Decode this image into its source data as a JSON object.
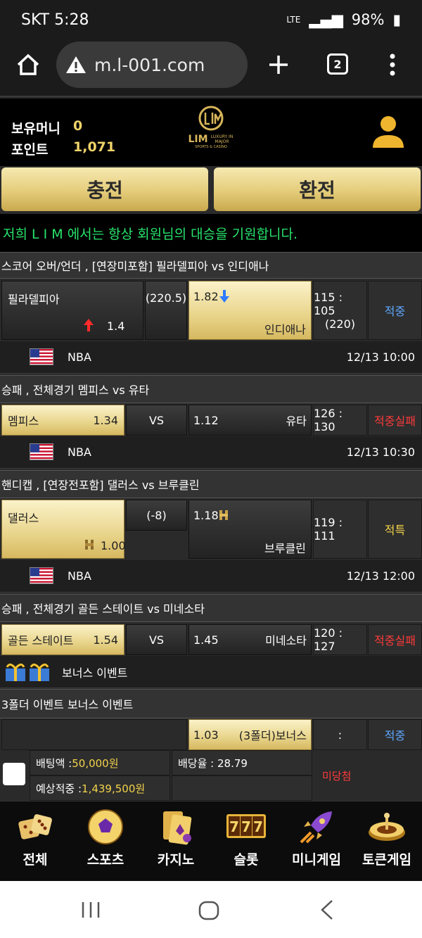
{
  "status_bar": {
    "carrier_time": "SKT 5:28",
    "battery": "98%",
    "network": "LTE"
  },
  "browser": {
    "url": "m.l-001.com",
    "tab_count": "2"
  },
  "header": {
    "money_label": "보유머니",
    "money_value": "0",
    "points_label": "포인트",
    "points_value": "1,071",
    "logo_text": "LIM",
    "logo_sub": "LUXURY IN MAJOR",
    "logo_tag": "SPORTS & CASINO"
  },
  "actions": {
    "deposit": "충전",
    "withdraw": "환전"
  },
  "marquee": "저희 L I M 에서는 항상 회원님의 대승을 기원합니다.",
  "bets": [
    {
      "title": "스코어 오버/언더 , [연장미포함] 필라델피아  vs  인디애나",
      "home": "필라델피아",
      "home_odds": "1.4",
      "middle": "(220.5)",
      "away": "인디애나",
      "away_odds": "1.82",
      "score": "115 : 105",
      "score_sub": "(220)",
      "result": "적중",
      "league": "NBA",
      "time": "12/13 10:00"
    },
    {
      "title": "승패 , 전체경기 멤피스  vs  유타",
      "home": "멤피스",
      "home_odds": "1.34",
      "middle": "VS",
      "away": "유타",
      "away_odds": "1.12",
      "score": "126 : 130",
      "result": "적중실패",
      "league": "NBA",
      "time": "12/13 10:30"
    },
    {
      "title": "핸디캡 , [연장전포함] 댈러스  vs  브루클린",
      "home": "댈러스",
      "home_odds": "1.00",
      "middle": "(-8)",
      "away": "브루클린",
      "away_odds": "1.18",
      "score": "119 : 111",
      "result": "적특",
      "league": "NBA",
      "time": "12/13 12:00"
    },
    {
      "title": "승패 , 전체경기 골든 스테이트  vs  미네소타",
      "home": "골든 스테이트",
      "home_odds": "1.54",
      "middle": "VS",
      "away": "미네소타",
      "away_odds": "1.45",
      "score": "120 : 127",
      "result": "적중실패"
    }
  ],
  "bonus_event": {
    "label": "보너스 이벤트"
  },
  "bonus_bet": {
    "title": "3폴더 이벤트 보너스 이벤트",
    "odds": "1.03",
    "label": "(3폴더)보너스",
    "score": ":",
    "result": "적중"
  },
  "summary": {
    "bet_amount_label": "배팅액 : ",
    "bet_amount": "50,000원",
    "odds_label": "배당율 : 28.79",
    "expected_label": "예상적중 : ",
    "expected": "1,439,500원",
    "status": "미당첨"
  },
  "nav": [
    "전체",
    "스포츠",
    "카지노",
    "슬롯",
    "미니게임",
    "토큰게임"
  ],
  "colors": {
    "gold": "#e4cc7a",
    "hit": "#5fa8ff",
    "miss": "#ff3b3b",
    "void": "#f2d24a",
    "marquee": "#27e36b"
  }
}
